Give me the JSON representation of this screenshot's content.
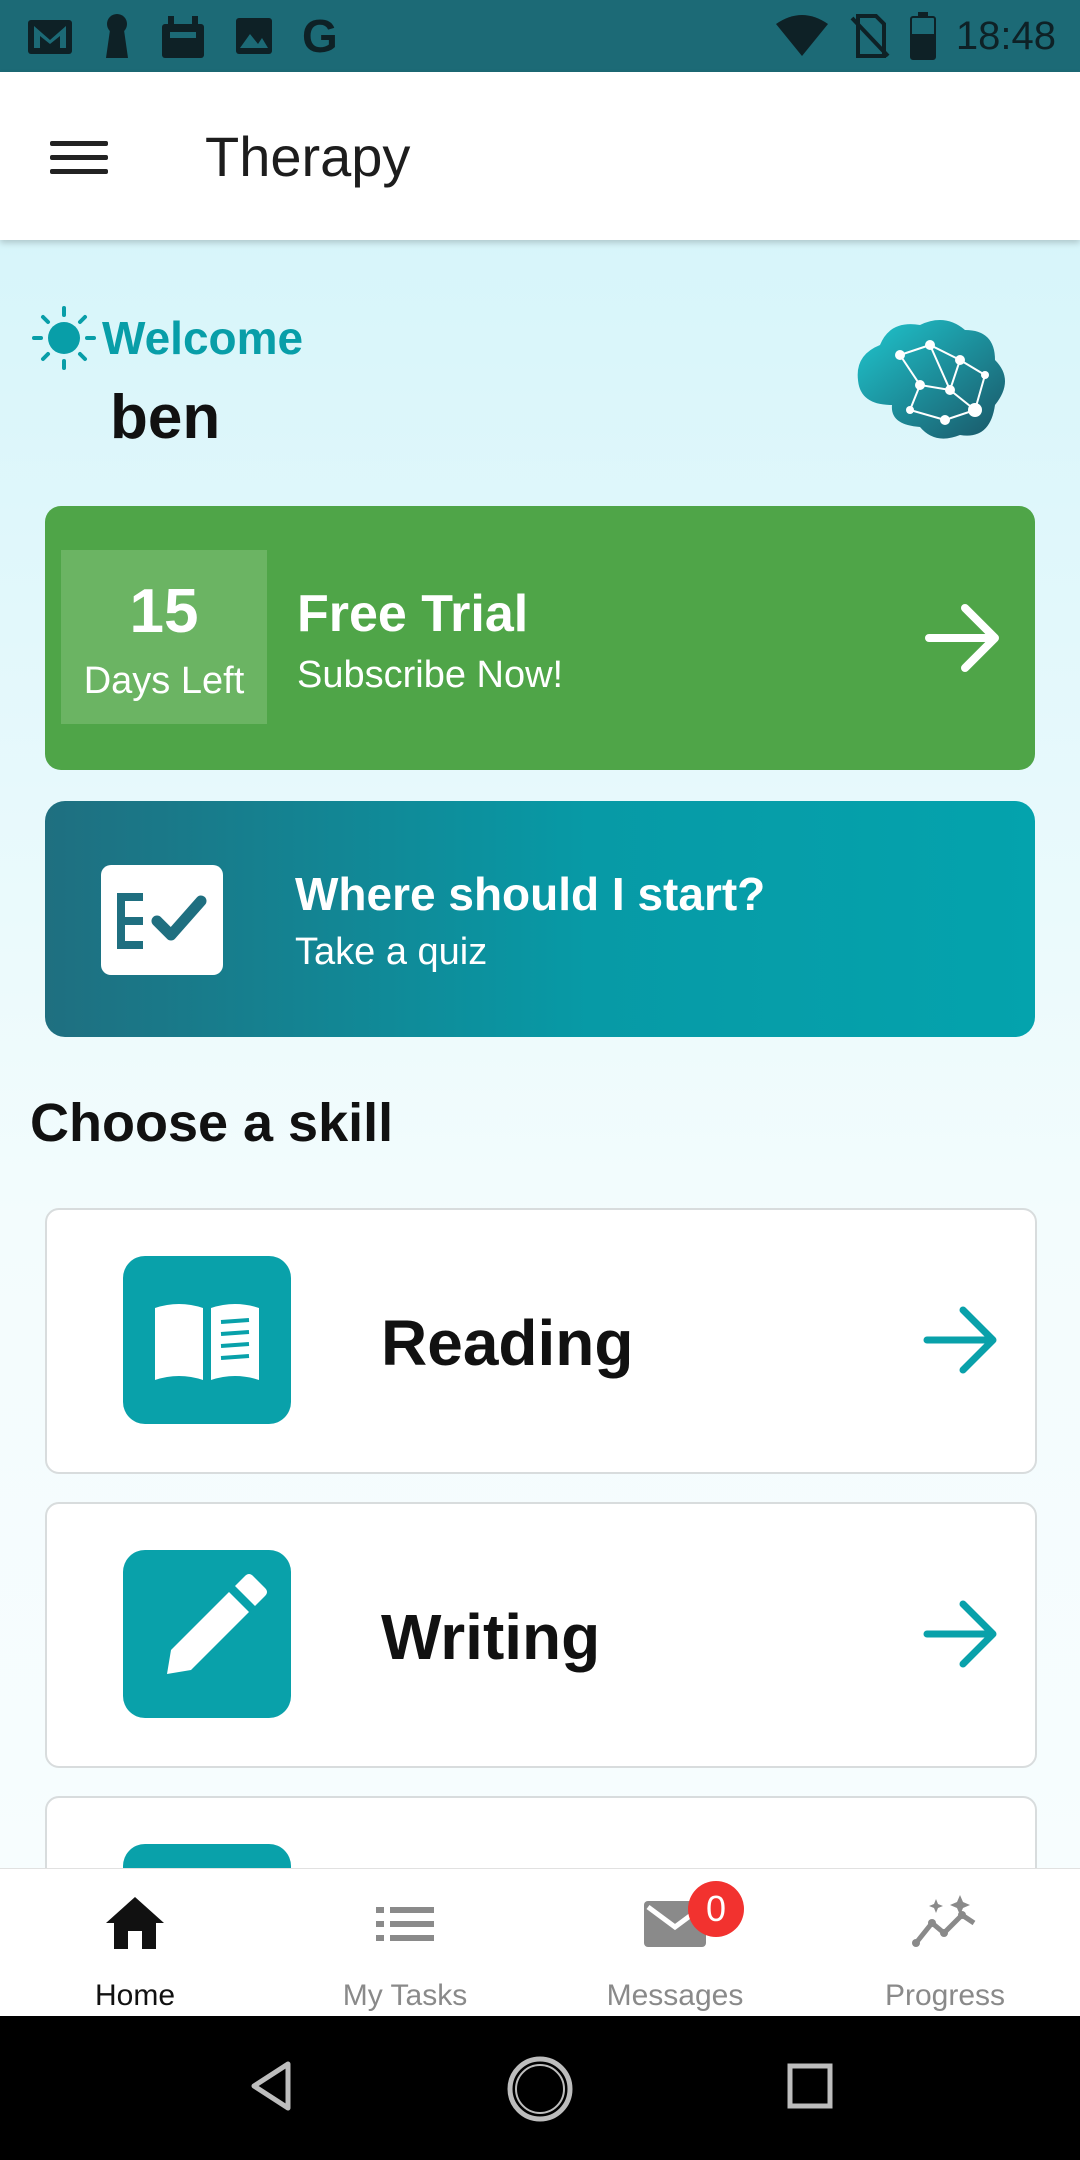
{
  "status_bar": {
    "time": "18:48",
    "left_icons": [
      "gmail-icon",
      "keyhole-icon",
      "robot-icon",
      "image-icon",
      "google-icon"
    ],
    "right_icons": [
      "wifi-icon",
      "no-sim-icon",
      "battery-icon"
    ],
    "google_letter": "G"
  },
  "app_bar": {
    "title": "Therapy",
    "menu_icon": "hamburger-menu-icon"
  },
  "welcome": {
    "greeting": "Welcome",
    "username": "ben"
  },
  "trial_card": {
    "days_count": "15",
    "days_label": "Days Left",
    "title": "Free Trial",
    "subtitle": "Subscribe Now!"
  },
  "quiz_card": {
    "title": "Where should I start?",
    "subtitle": "Take a quiz"
  },
  "section": {
    "title": "Choose a skill"
  },
  "skills": [
    {
      "label": "Reading",
      "icon": "book-icon"
    },
    {
      "label": "Writing",
      "icon": "pencil-icon"
    }
  ],
  "bottom_nav": {
    "items": [
      {
        "label": "Home",
        "icon": "home-icon",
        "active": true
      },
      {
        "label": "My Tasks",
        "icon": "list-icon",
        "active": false
      },
      {
        "label": "Messages",
        "icon": "mail-icon",
        "active": false,
        "badge": "0"
      },
      {
        "label": "Progress",
        "icon": "progress-icon",
        "active": false
      }
    ]
  },
  "colors": {
    "status_bar": "#1c6a76",
    "accent_teal": "#09a1aa",
    "trial_green": "#4fa548",
    "badge_red": "#f2322f"
  }
}
